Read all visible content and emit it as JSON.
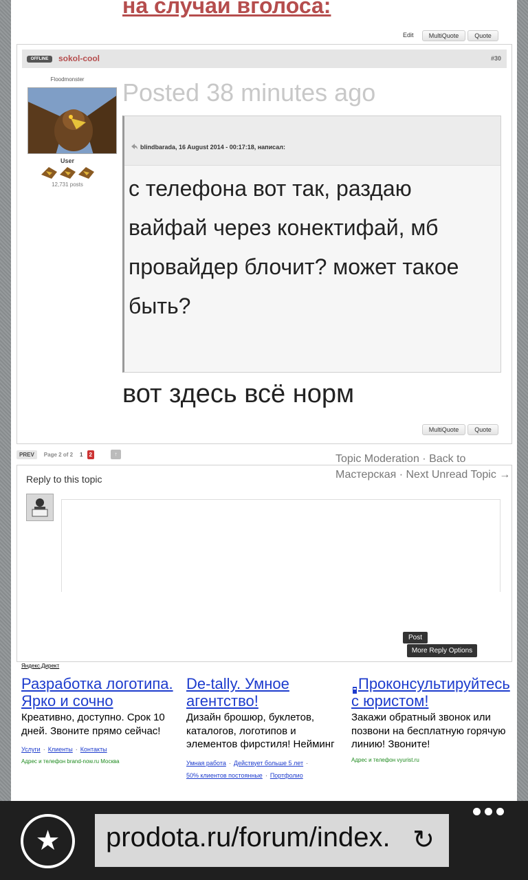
{
  "top": {
    "title": "на случай вголоса:",
    "edit": "Edit",
    "multiquote": "MultiQuote",
    "quote": "Quote"
  },
  "post": {
    "status": "OFFLINE",
    "author": "sokol-cool",
    "number": "#30",
    "rank": "Floodmonster",
    "group": "User",
    "post_count": "12,731 posts",
    "posted": "Posted 38 minutes ago",
    "quote_citation": "blindbarada, 16 August 2014 - 00:17:18, написал:",
    "quote_body": "с телефона вот так, раздаю вайфай через конектифай, мб провайдер блочит? может такое быть?",
    "reply_text": "вот здесь всё норм",
    "multiquote": "MultiQuote",
    "quote": "Quote"
  },
  "pager": {
    "prev": "PREV",
    "page_label": "Page 2 of 2",
    "page1": "1",
    "page2": "2",
    "up": "↑"
  },
  "moderation": {
    "topic_moderation": "Topic Moderation",
    "sep1": " · ",
    "back_to": "Back to Мастерская",
    "sep2": " · ",
    "next_unread": "Next Unread Topic →"
  },
  "reply": {
    "label": "Reply to this topic",
    "post_button": "Post",
    "more_options": "More Reply Options"
  },
  "ads": {
    "source": "Яндекс.Директ",
    "items": [
      {
        "title": "Разработка логотипа. Ярко и сочно",
        "text": "Креативно, доступно. Срок 10 дней. Звоните прямо сейчас!",
        "links": [
          "Услуги",
          "Клиенты",
          "Контакты"
        ],
        "meta": "Адрес и телефон  brand-now.ru  Москва"
      },
      {
        "title": "De-tally. Умное агентство!",
        "text": "Дизайн брошюр, буклетов, каталогов, логотипов и элементов фирстиля! Нейминг",
        "links": [
          "Умная работа",
          "Действует больше 5 лет",
          "50% клиентов постоянные",
          "Портфолио"
        ],
        "meta": ""
      },
      {
        "title": "Проконсультируйтесь с юристом!",
        "text": "Закажи обратный звонок или позвони на бесплатную горячую линию! Звоните!",
        "links": [],
        "meta": "Адрес и телефон  vyurist.ru"
      }
    ]
  },
  "browser": {
    "url": "prodota.ru/forum/index.",
    "favorites_icon": "star-icon",
    "refresh_icon": "refresh-icon",
    "menu_icon": "more-dots-icon"
  }
}
